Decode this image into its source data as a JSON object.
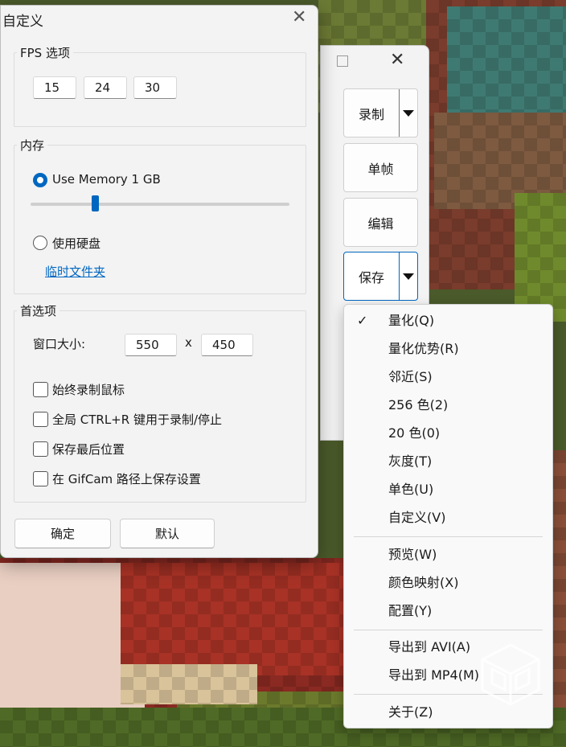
{
  "dialog": {
    "title": "自定义",
    "close_icon": "close-icon",
    "fps_group": {
      "label": "FPS 选项",
      "values": [
        "15",
        "24",
        "30"
      ]
    },
    "memory_group": {
      "label": "内存",
      "use_memory_label": "Use Memory 1 GB",
      "use_memory_selected": true,
      "memory_slider_fraction": 0.25,
      "use_disk_label": "使用硬盘",
      "temp_folder_link": "临时文件夹"
    },
    "prefs_group": {
      "label": "首选项",
      "window_size_label": "窗口大小:",
      "width": "550",
      "times": "x",
      "height": "450",
      "checkboxes": [
        "始终录制鼠标",
        "全局 CTRL+R 键用于录制/停止",
        "保存最后位置",
        "在 GifCam 路径上保存设置"
      ]
    },
    "ok_button": "确定",
    "default_button": "默认"
  },
  "gifcam": {
    "buttons": {
      "record": "录制",
      "frame": "单帧",
      "edit": "编辑",
      "save": "保存"
    }
  },
  "save_menu": {
    "group1": [
      "量化(Q)",
      "量化优势(R)",
      "邻近(S)",
      "256 色(2)",
      "20 色(0)",
      "灰度(T)",
      "单色(U)",
      "自定义(V)"
    ],
    "checked_index": 0,
    "group2": [
      "预览(W)",
      "颜色映射(X)",
      "配置(Y)"
    ],
    "group3": [
      "导出到 AVI(A)",
      "导出到 MP4(M)"
    ],
    "group4": [
      "关于(Z)"
    ]
  },
  "colors": {
    "accent": "#0067c0",
    "dialog_bg": "#f3f3f3",
    "menu_bg": "#f9f9f9"
  }
}
